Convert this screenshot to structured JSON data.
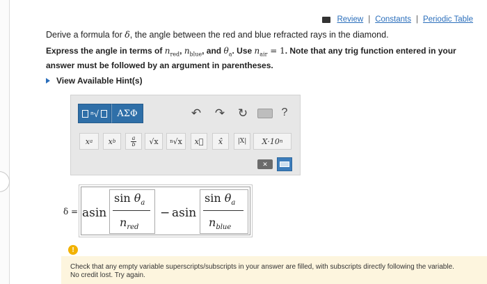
{
  "links": {
    "review": "Review",
    "constants": "Constants",
    "periodic_table": "Periodic Table",
    "separator": "|"
  },
  "question": {
    "line1_prefix": "Derive a formula for ",
    "line1_symbol": "δ",
    "line1_suffix": ", the angle between the red and blue refracted rays in the diamond.",
    "line2_a": "Express the angle in terms of ",
    "n": "n",
    "red": "red",
    "blue": "blue",
    "comma": ", ",
    "and": " and ",
    "theta": "θ",
    "a": "a",
    "use": ". Use ",
    "air": "air",
    "eq_one": " = 1",
    "line2_b": ". Note that any trig function entered in your answer must be followed by an argument in parentheses."
  },
  "hints": {
    "label": "View Available Hint(s)"
  },
  "toolbar": {
    "templates_glyph": "√□",
    "greek_label": "ΑΣΦ",
    "undo": "↶",
    "redo": "↷",
    "reset": "↻",
    "help": "?"
  },
  "palette": {
    "x": "x",
    "a_sup": "a",
    "b_sub": "b",
    "frac_a": "a",
    "frac_b": "b",
    "sqrt": "√x",
    "nroot_n": "n",
    "nroot": "√x",
    "vec": "x⃗",
    "hat": "x̂",
    "abs": "|X|",
    "sci": "X·10",
    "sci_n": "n",
    "del": "✕"
  },
  "answer": {
    "lhs": "δ =",
    "asin": "asin",
    "sin": "sin",
    "theta": "θ",
    "a": "a",
    "minus": "−",
    "n": "n",
    "red": "red",
    "blue": "blue"
  },
  "warning": {
    "icon": "!",
    "text_line1": "Check that any empty variable superscripts/subscripts in your answer are filled, with subscripts directly following the variable.",
    "text_line2": "No credit lost. Try again."
  }
}
